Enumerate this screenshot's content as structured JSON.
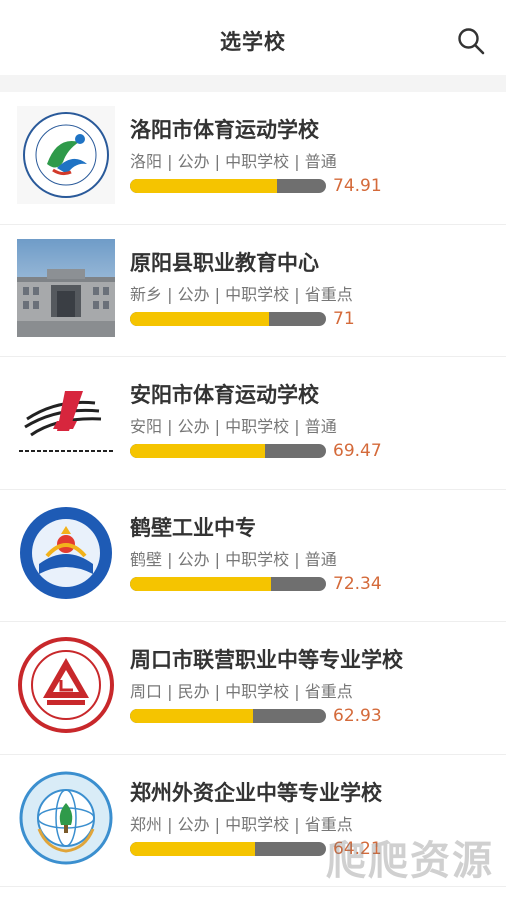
{
  "header": {
    "title": "选学校",
    "search_icon": "search-icon"
  },
  "schools": [
    {
      "name": "洛阳市体育运动学校",
      "meta": "洛阳 | 公办 | 中职学校 | 普通",
      "score": "74.91",
      "score_fraction": 0.75,
      "logo": "sports-school-logo-icon"
    },
    {
      "name": "原阳县职业教育中心",
      "meta": "新乡 | 公办 | 中职学校 | 省重点",
      "score": "71",
      "score_fraction": 0.71,
      "logo": "campus-building-photo"
    },
    {
      "name": "安阳市体育运动学校",
      "meta": "安阳 | 公办 | 中职学校 | 普通",
      "score": "69.47",
      "score_fraction": 0.69,
      "logo": "running-track-logo-icon"
    },
    {
      "name": "鹤壁工业中专",
      "meta": "鹤壁 | 公办 | 中职学校 | 普通",
      "score": "72.34",
      "score_fraction": 0.72,
      "logo": "industrial-school-badge-icon"
    },
    {
      "name": "周口市联营职业中等专业学校",
      "meta": "周口 | 民办 | 中职学校 | 省重点",
      "score": "62.93",
      "score_fraction": 0.63,
      "logo": "vocational-school-seal-icon"
    },
    {
      "name": "郑州外资企业中等专业学校",
      "meta": "郑州 | 公办 | 中职学校 | 省重点",
      "score": "64.21",
      "score_fraction": 0.64,
      "logo": "globe-wreath-badge-icon"
    }
  ],
  "watermark": "爬爬资源",
  "colors": {
    "bar_fill": "#f5c400",
    "bar_track": "#6f6f6f",
    "score": "#d46a3a"
  }
}
